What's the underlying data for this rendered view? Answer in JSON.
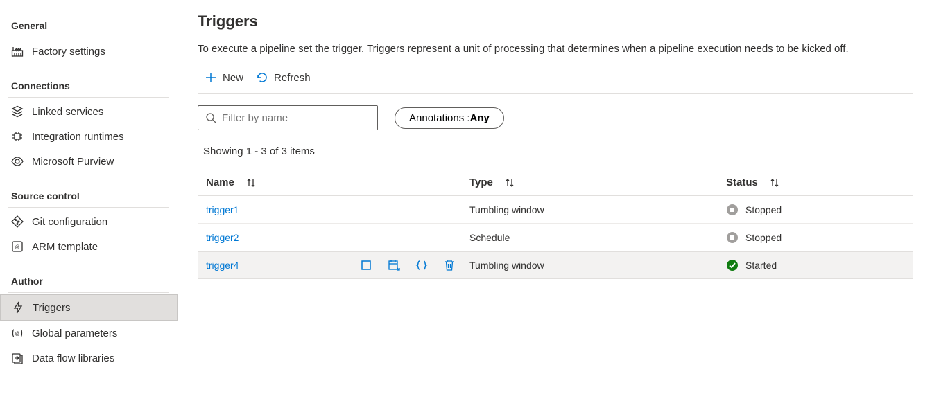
{
  "sidebar": {
    "sections": [
      {
        "title": "General",
        "items": [
          {
            "label": "Factory settings"
          }
        ]
      },
      {
        "title": "Connections",
        "items": [
          {
            "label": "Linked services"
          },
          {
            "label": "Integration runtimes"
          },
          {
            "label": "Microsoft Purview"
          }
        ]
      },
      {
        "title": "Source control",
        "items": [
          {
            "label": "Git configuration"
          },
          {
            "label": "ARM template"
          }
        ]
      },
      {
        "title": "Author",
        "items": [
          {
            "label": "Triggers",
            "active": true
          },
          {
            "label": "Global parameters"
          },
          {
            "label": "Data flow libraries"
          }
        ]
      }
    ]
  },
  "page": {
    "title": "Triggers",
    "description": "To execute a pipeline set the trigger. Triggers represent a unit of processing that determines when a pipeline execution needs to be kicked off."
  },
  "toolbar": {
    "new_label": "New",
    "refresh_label": "Refresh"
  },
  "filters": {
    "search_placeholder": "Filter by name",
    "annotations_label": "Annotations : ",
    "annotations_value": "Any"
  },
  "table": {
    "showing": "Showing 1 - 3 of 3 items",
    "columns": {
      "name": "Name",
      "type": "Type",
      "status": "Status"
    },
    "rows": [
      {
        "name": "trigger1",
        "type": "Tumbling window",
        "status": "Stopped",
        "status_kind": "stopped"
      },
      {
        "name": "trigger2",
        "type": "Schedule",
        "status": "Stopped",
        "status_kind": "stopped"
      },
      {
        "name": "trigger4",
        "type": "Tumbling window",
        "status": "Started",
        "status_kind": "started",
        "hovered": true
      }
    ]
  }
}
